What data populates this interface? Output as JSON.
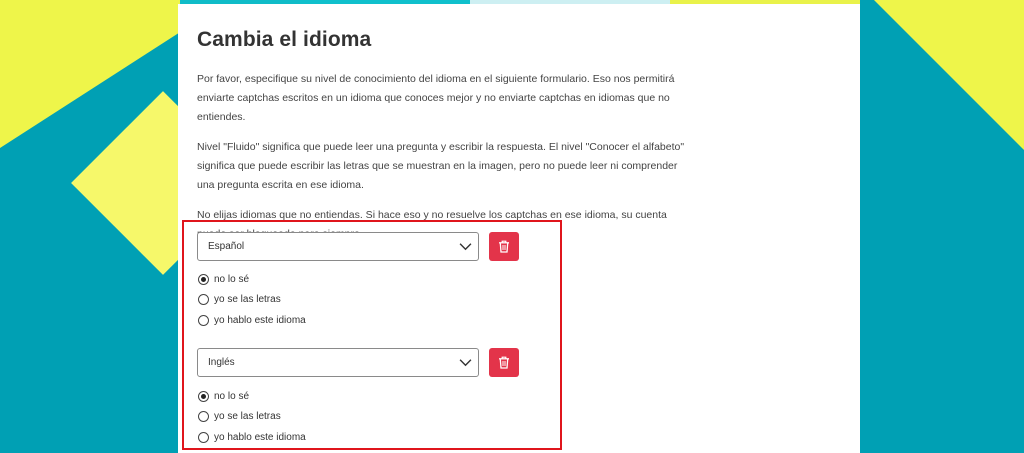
{
  "page": {
    "title": "Cambia el idioma",
    "paragraphs": [
      "Por favor, especifique su nivel de conocimiento del idioma en el siguiente formulario. Eso nos permitirá enviarte captchas escritos en un idioma que conoces mejor y no enviarte captchas en idiomas que no entiendes.",
      "Nivel \"Fluido\" significa que puede leer una pregunta y escribir la respuesta. El nivel \"Conocer el alfabeto\" significa que puede escribir las letras que se muestran en la imagen, pero no puede leer ni comprender una pregunta escrita en ese idioma.",
      "No elijas idiomas que no entiendas. Si hace eso y no resuelve los captchas en ese idioma, su cuenta puede ser bloqueada para siempre."
    ]
  },
  "languages": [
    {
      "selected": "Español",
      "options": [
        "no lo sé",
        "yo se las letras",
        "yo hablo este idioma"
      ],
      "checked_index": 0
    },
    {
      "selected": "Inglés",
      "options": [
        "no lo sé",
        "yo se las letras",
        "yo hablo este idioma"
      ],
      "checked_index": 0
    }
  ],
  "colors": {
    "background": "#00a0b4",
    "accent_yellow": "#eef54a",
    "delete_button": "#e3344a",
    "highlight_border": "#e0151c"
  },
  "icons": {
    "dropdown": "chevron-down-icon",
    "delete": "trash-icon"
  }
}
